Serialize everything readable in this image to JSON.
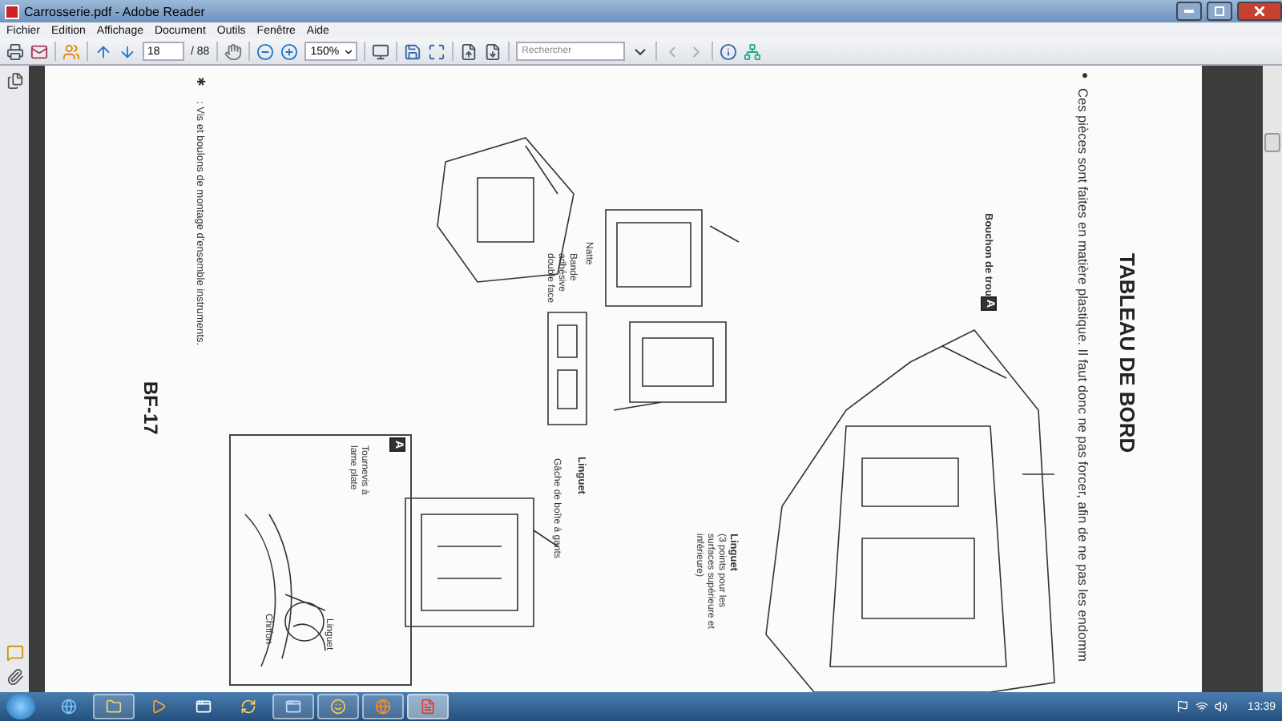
{
  "window": {
    "title": "Carrosserie.pdf - Adobe Reader"
  },
  "menu": [
    "Fichier",
    "Edition",
    "Affichage",
    "Document",
    "Outils",
    "Fenêtre",
    "Aide"
  ],
  "toolbar": {
    "page": "18",
    "page_count": "/ 88",
    "zoom": "150%",
    "search_placeholder": "Rechercher"
  },
  "document": {
    "texts": [
      {
        "kind": "heading",
        "text": "TABLEAU DE BORD"
      },
      {
        "kind": "bullet",
        "text": "●"
      },
      {
        "kind": "body",
        "text": "Ces pièces sont faites en matière plastique. Il faut donc ne pas forcer, afin de ne pas les endomm"
      },
      {
        "kind": "label-bold",
        "text": "Bouchon de trou"
      },
      {
        "kind": "badge",
        "text": "A"
      },
      {
        "kind": "label-bold",
        "text": "Linguet"
      },
      {
        "kind": "label",
        "text": "(3 points pour les surfaces supérieure et inférieure)"
      },
      {
        "kind": "label-bold",
        "text": "Linguet"
      },
      {
        "kind": "label",
        "text": "Gâche de boîte à gants"
      },
      {
        "kind": "label",
        "text": "Natte"
      },
      {
        "kind": "label",
        "text": "Bande adhésive double face"
      },
      {
        "kind": "bullet",
        "text": "✱"
      },
      {
        "kind": "note",
        "text": ": Vis et boulons de montage d'ensemble instruments."
      },
      {
        "kind": "page-number",
        "text": "BF-17"
      },
      {
        "kind": "badge",
        "text": "A"
      },
      {
        "kind": "label",
        "text": "Tournevis à lame plate"
      },
      {
        "kind": "label",
        "text": "Chiffon"
      },
      {
        "kind": "label",
        "text": "Linguet"
      }
    ]
  },
  "taskbar": {
    "apps": [
      {
        "kind": "browser",
        "running": false,
        "selected": false
      },
      {
        "kind": "folder",
        "running": true,
        "selected": false
      },
      {
        "kind": "media",
        "running": false,
        "selected": false
      },
      {
        "kind": "app",
        "running": false,
        "selected": false
      },
      {
        "kind": "sync",
        "running": false,
        "selected": false
      },
      {
        "kind": "window",
        "running": true,
        "selected": false
      },
      {
        "kind": "chat",
        "running": true,
        "selected": false
      },
      {
        "kind": "globe",
        "running": true,
        "selected": false
      },
      {
        "kind": "pdf",
        "running": true,
        "selected": true
      }
    ],
    "clock": "13:39"
  }
}
